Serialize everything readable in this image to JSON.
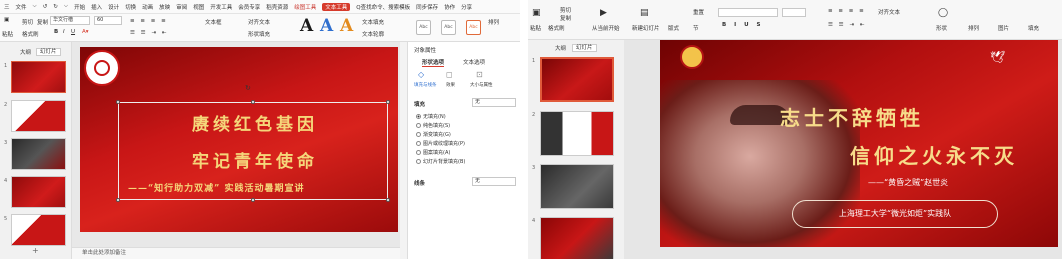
{
  "left_app": {
    "menu": [
      "三",
      "文件",
      "⌵",
      "↺",
      "↻",
      "⌵",
      "开始",
      "插入",
      "设计",
      "切换",
      "动画",
      "放映",
      "审阅",
      "视图",
      "开发工具",
      "会员专享",
      "稻壳资源",
      "绘图工具",
      "文本工具",
      "Q查找命令、搜索模板",
      "同步保存",
      "协作",
      "分享"
    ],
    "active_tab": "文本工具",
    "highlight_tab": "绘图工具",
    "toolbar": {
      "paste": "粘贴",
      "format_painter": "格式刷",
      "cut": "剪切",
      "copy": "复制",
      "font": "华文行楷",
      "size": "60",
      "bold": "B",
      "italic": "I",
      "underline": "U",
      "align": "对齐文本",
      "text_box": "文本框",
      "text_fill": "文本填充",
      "text_outline": "文本轮廓",
      "text_effect": "文本效果",
      "shape_fill": "形状填充",
      "shape_outline": "形状轮廓",
      "arrange": "排列",
      "abc": [
        "Abc",
        "Abc",
        "Abc"
      ],
      "big_a": "A"
    },
    "panel_tabs": [
      "大纲",
      "幻灯片"
    ],
    "thumb_numbers": [
      "1",
      "2",
      "3",
      "4",
      "5"
    ],
    "slide": {
      "line1": "赓续红色基因",
      "line2": "牢记青年使命",
      "line3": "——“知行助力双减” 实践活动暑期宣讲"
    },
    "status": "单击此处添加备注",
    "panel": {
      "title": "对象属性",
      "tab1": "形状选项",
      "tab2": "文本选项",
      "sub": [
        "填充与线条",
        "效果",
        "大小与属性"
      ],
      "fill_label": "填充",
      "fill_value": "无",
      "options": [
        "无填充(N)",
        "纯色填充(S)",
        "渐变填充(G)",
        "图片或纹理填充(P)",
        "图案填充(A)",
        "幻灯片背景填充(B)"
      ],
      "line_label": "线条",
      "line_value": "无"
    }
  },
  "right_app": {
    "toolbar": [
      "粘贴",
      "格式刷",
      "剪切",
      "复制",
      "从当前开始",
      "新建幻灯片",
      "版式",
      "节",
      "重置",
      "对齐文本",
      "形状",
      "排列",
      "图片",
      "填充"
    ],
    "panel_tabs": [
      "大纲",
      "幻灯片"
    ],
    "thumb_numbers": [
      "1",
      "2",
      "3",
      "4"
    ],
    "slide": {
      "line1": "志士不辞牺牲",
      "line2": "信仰之火永不灭",
      "line3": "——“黄昏之贼”赵世炎",
      "badge": "上海理工大学“微光如炬”实践队"
    }
  },
  "colors": {
    "accent": "#d63a2b",
    "slide_red": "#c81616",
    "gold": "#f5d67a"
  }
}
